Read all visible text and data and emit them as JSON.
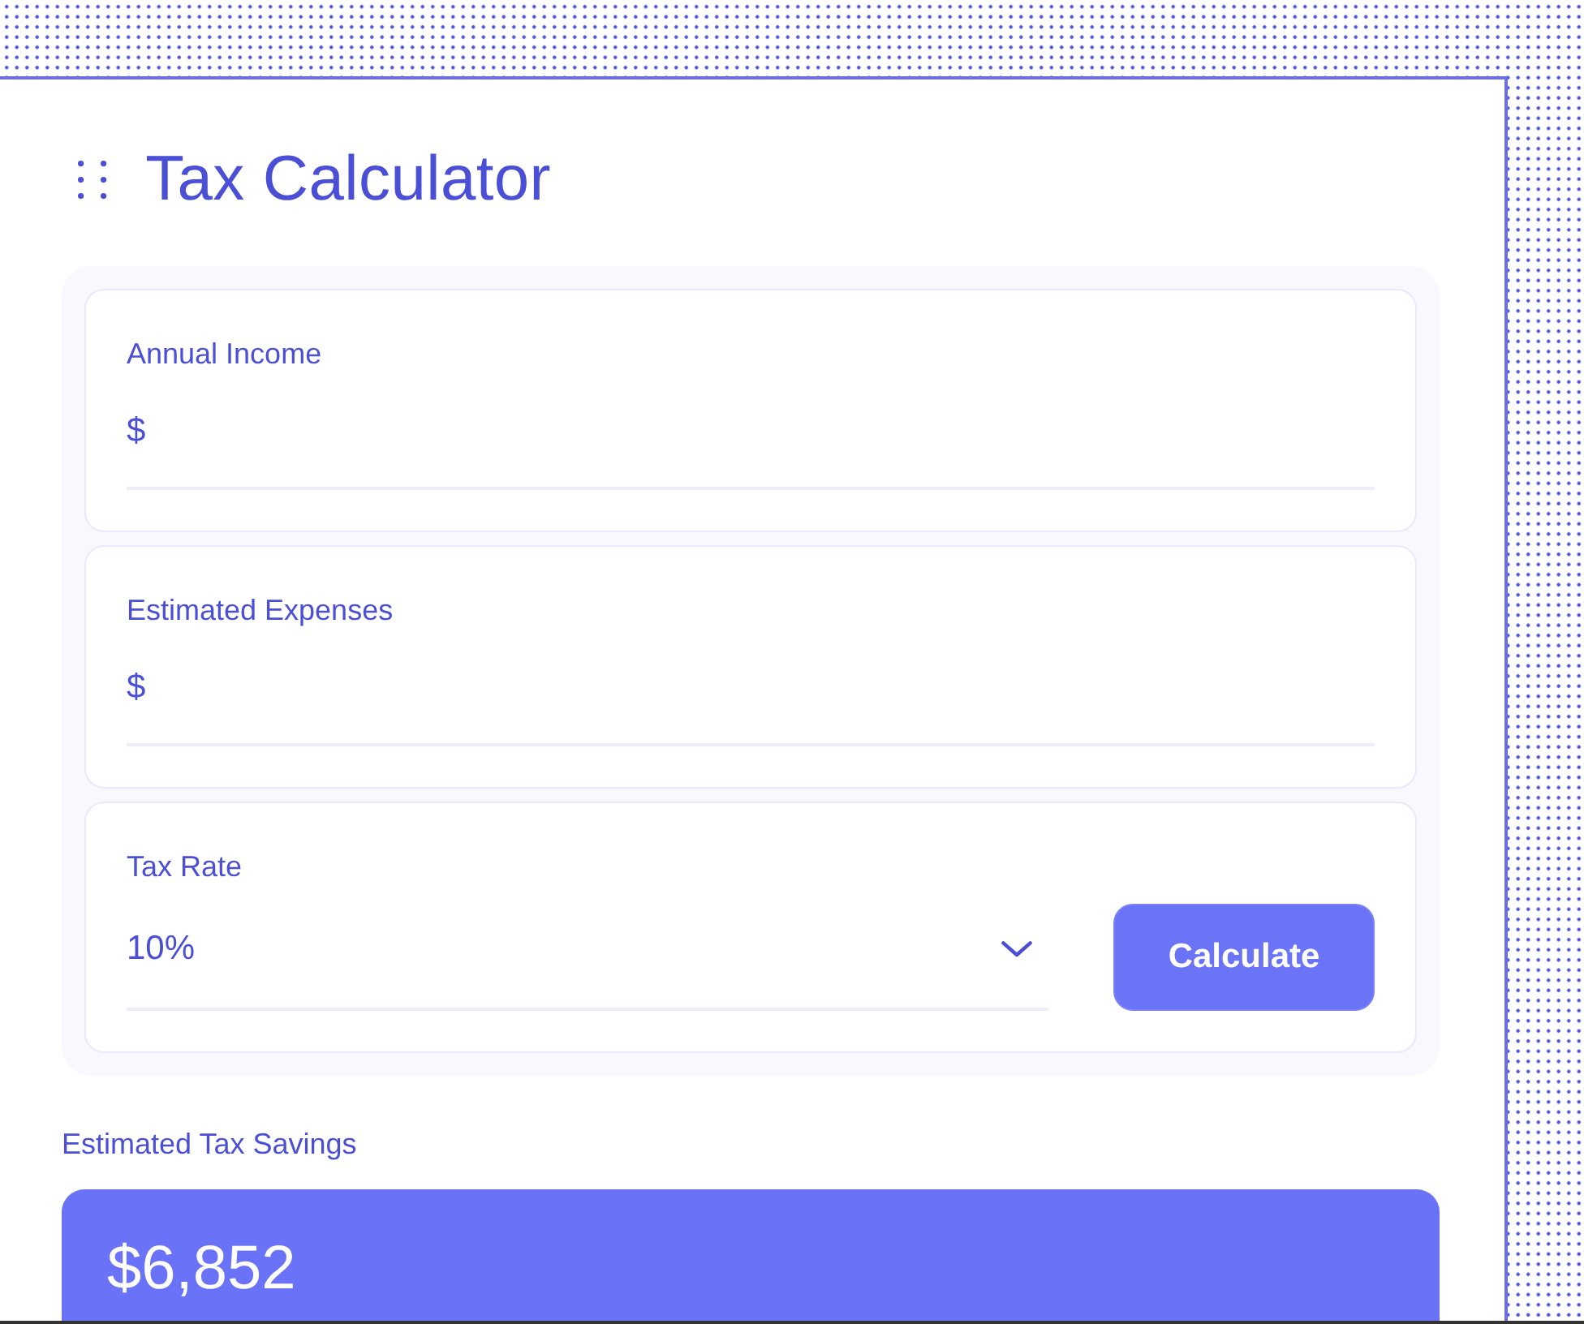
{
  "app": {
    "title": "Tax Calculator"
  },
  "form": {
    "fields": [
      {
        "kind": "input",
        "label": "Annual Income",
        "prefix": "$"
      },
      {
        "kind": "input",
        "label": "Estimated Expenses",
        "prefix": "$"
      },
      {
        "kind": "select",
        "label": "Tax Rate",
        "value": "10%"
      }
    ],
    "submit_button": "Calculate"
  },
  "result": {
    "label": "Estimated Tax Savings",
    "value": "$6,852"
  }
}
